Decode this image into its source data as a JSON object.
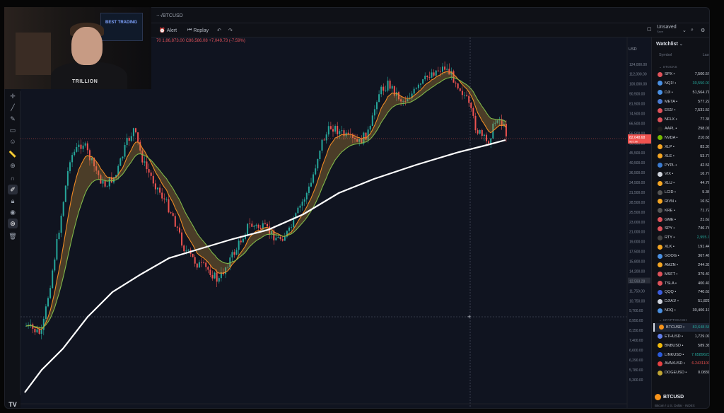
{
  "title_bar": {
    "symbol": "⋯/BTCUSD"
  },
  "toolbar": {
    "alert_label": "Alert",
    "replay_label": "Replay",
    "unsaved_label": "Unsaved",
    "unsaved_sub": "Save"
  },
  "legend": {
    "values": "70  1,86,873.00  C86,586.08  +7,049.73 (-7.59%)"
  },
  "currency": "USD",
  "price_axis": {
    "ticks": [
      "124,000.00",
      "112,000.00",
      "100,000.00",
      "90,500.00",
      "81,500.00",
      "74,500.00",
      "66,500.00",
      "56,500.00",
      "50,500.00",
      "45,500.00",
      "40,500.00",
      "36,500.00",
      "34,500.00",
      "31,500.00",
      "28,500.00",
      "25,500.00",
      "23,000.00",
      "21,000.00",
      "19,000.00",
      "17,500.00",
      "15,800.00",
      "14,200.00",
      "12,593.28",
      "11,750.00",
      "10,750.00",
      "9,700.00",
      "8,950.00",
      "8,150.00",
      "7,400.00",
      "6,600.00",
      "6,290.00",
      "5,780.00",
      "5,300.00"
    ],
    "current_price": "82,648.68",
    "current_time": "9d 10h",
    "crosshair_price": "12,593.28"
  },
  "watchlist": {
    "title": "Watchlist",
    "col_symbol": "Symbol",
    "col_last": "Last",
    "section_stocks": "STOCKS",
    "section_crypto": "CRYPTOCASH",
    "stocks": [
      {
        "symbol": "SPX",
        "last": "7,500.57",
        "tone": "",
        "icon": "#e0525a"
      },
      {
        "symbol": "NQ1!",
        "last": "30,550.00",
        "tone": "pos",
        "icon": "#4a90e2"
      },
      {
        "symbol": "DJI",
        "last": "51,564.71",
        "tone": "",
        "icon": "#4a90e2"
      },
      {
        "symbol": "META",
        "last": "577.22",
        "tone": "",
        "icon": "#4a7bd1"
      },
      {
        "symbol": "ES1!",
        "last": "7,531.50",
        "tone": "",
        "icon": "#e0525a"
      },
      {
        "symbol": "NFLX",
        "last": "77.38",
        "tone": "",
        "icon": "#e0525a"
      },
      {
        "symbol": "AAPL",
        "last": "298.01",
        "tone": "",
        "icon": "#1e1e1e"
      },
      {
        "symbol": "NVDA",
        "last": "210.68",
        "tone": "",
        "icon": "#76b900"
      },
      {
        "symbol": "XLP",
        "last": "83.30",
        "tone": "",
        "icon": "#f5a623"
      },
      {
        "symbol": "XLE",
        "last": "53.77",
        "tone": "",
        "icon": "#f5a623"
      },
      {
        "symbol": "PYPL",
        "last": "42.51",
        "tone": "",
        "icon": "#3b7bd1"
      },
      {
        "symbol": "VIX",
        "last": "16.77",
        "tone": "",
        "icon": "#d0d4dc"
      },
      {
        "symbol": "XLU",
        "last": "44.76",
        "tone": "",
        "icon": "#f5a623"
      },
      {
        "symbol": "LCID",
        "last": "5.36",
        "tone": "",
        "icon": "#555"
      },
      {
        "symbol": "RIVN",
        "last": "16.52",
        "tone": "",
        "icon": "#f5a623"
      },
      {
        "symbol": "KRE",
        "last": "71.72",
        "tone": "",
        "icon": "#555"
      },
      {
        "symbol": "GME",
        "last": "21.62",
        "tone": "",
        "icon": "#e0525a"
      },
      {
        "symbol": "SPY",
        "last": "746.74",
        "tone": "",
        "icon": "#e0525a"
      },
      {
        "symbol": "RTY",
        "last": "2,955.7",
        "tone": "pos",
        "icon": "#444"
      },
      {
        "symbol": "XLK",
        "last": "191.44",
        "tone": "",
        "icon": "#f5a623"
      },
      {
        "symbol": "GOOG",
        "last": "367.46",
        "tone": "",
        "icon": "#4a90e2"
      },
      {
        "symbol": "AMZN",
        "last": "244.39",
        "tone": "",
        "icon": "#f5a623"
      },
      {
        "symbol": "MSFT",
        "last": "379.40",
        "tone": "",
        "icon": "#e0525a"
      },
      {
        "symbol": "TSLA",
        "last": "400.49",
        "tone": "",
        "icon": "#e0525a"
      },
      {
        "symbol": "QQQ",
        "last": "740.62",
        "tone": "",
        "icon": "#3b5bdb"
      },
      {
        "symbol": "DJIA1!",
        "last": "51,821",
        "tone": "",
        "icon": "#d0d4dc"
      },
      {
        "symbol": "NDQ",
        "last": "30,406.19",
        "tone": "",
        "icon": "#4a90e2"
      }
    ],
    "crypto": [
      {
        "symbol": "BTCUSD",
        "last": "83,648.58",
        "tone": "pos",
        "icon": "#f7931a",
        "selected": true
      },
      {
        "symbol": "ETHUSD",
        "last": "1,729.09",
        "tone": "",
        "icon": "#627eea"
      },
      {
        "symbol": "BNBUSD",
        "last": "589.38",
        "tone": "",
        "icon": "#f0b90b"
      },
      {
        "symbol": "LINKUSD",
        "last": "7.6589623",
        "tone": "pos",
        "icon": "#2a5ada"
      },
      {
        "symbol": "AVAXUSD",
        "last": "6.2431100",
        "tone": "neg",
        "icon": "#e84142"
      },
      {
        "symbol": "DOGEUSD",
        "last": "0.0831",
        "tone": "",
        "icon": "#c2a633"
      }
    ],
    "detail": {
      "symbol": "BTCUSD",
      "sub": "Bitcoin / U.S. Dollar  ·  INDEX"
    }
  },
  "webcam": {
    "monitor_text": "BEST TRADING",
    "shirt_text": "TRILLION"
  },
  "colors": {
    "bg": "#0f1117",
    "up": "#26a69a",
    "down": "#ef5350",
    "ema_fast": "#f08a24",
    "ema_slow": "#7fb84a",
    "sma": "#ffffff"
  }
}
